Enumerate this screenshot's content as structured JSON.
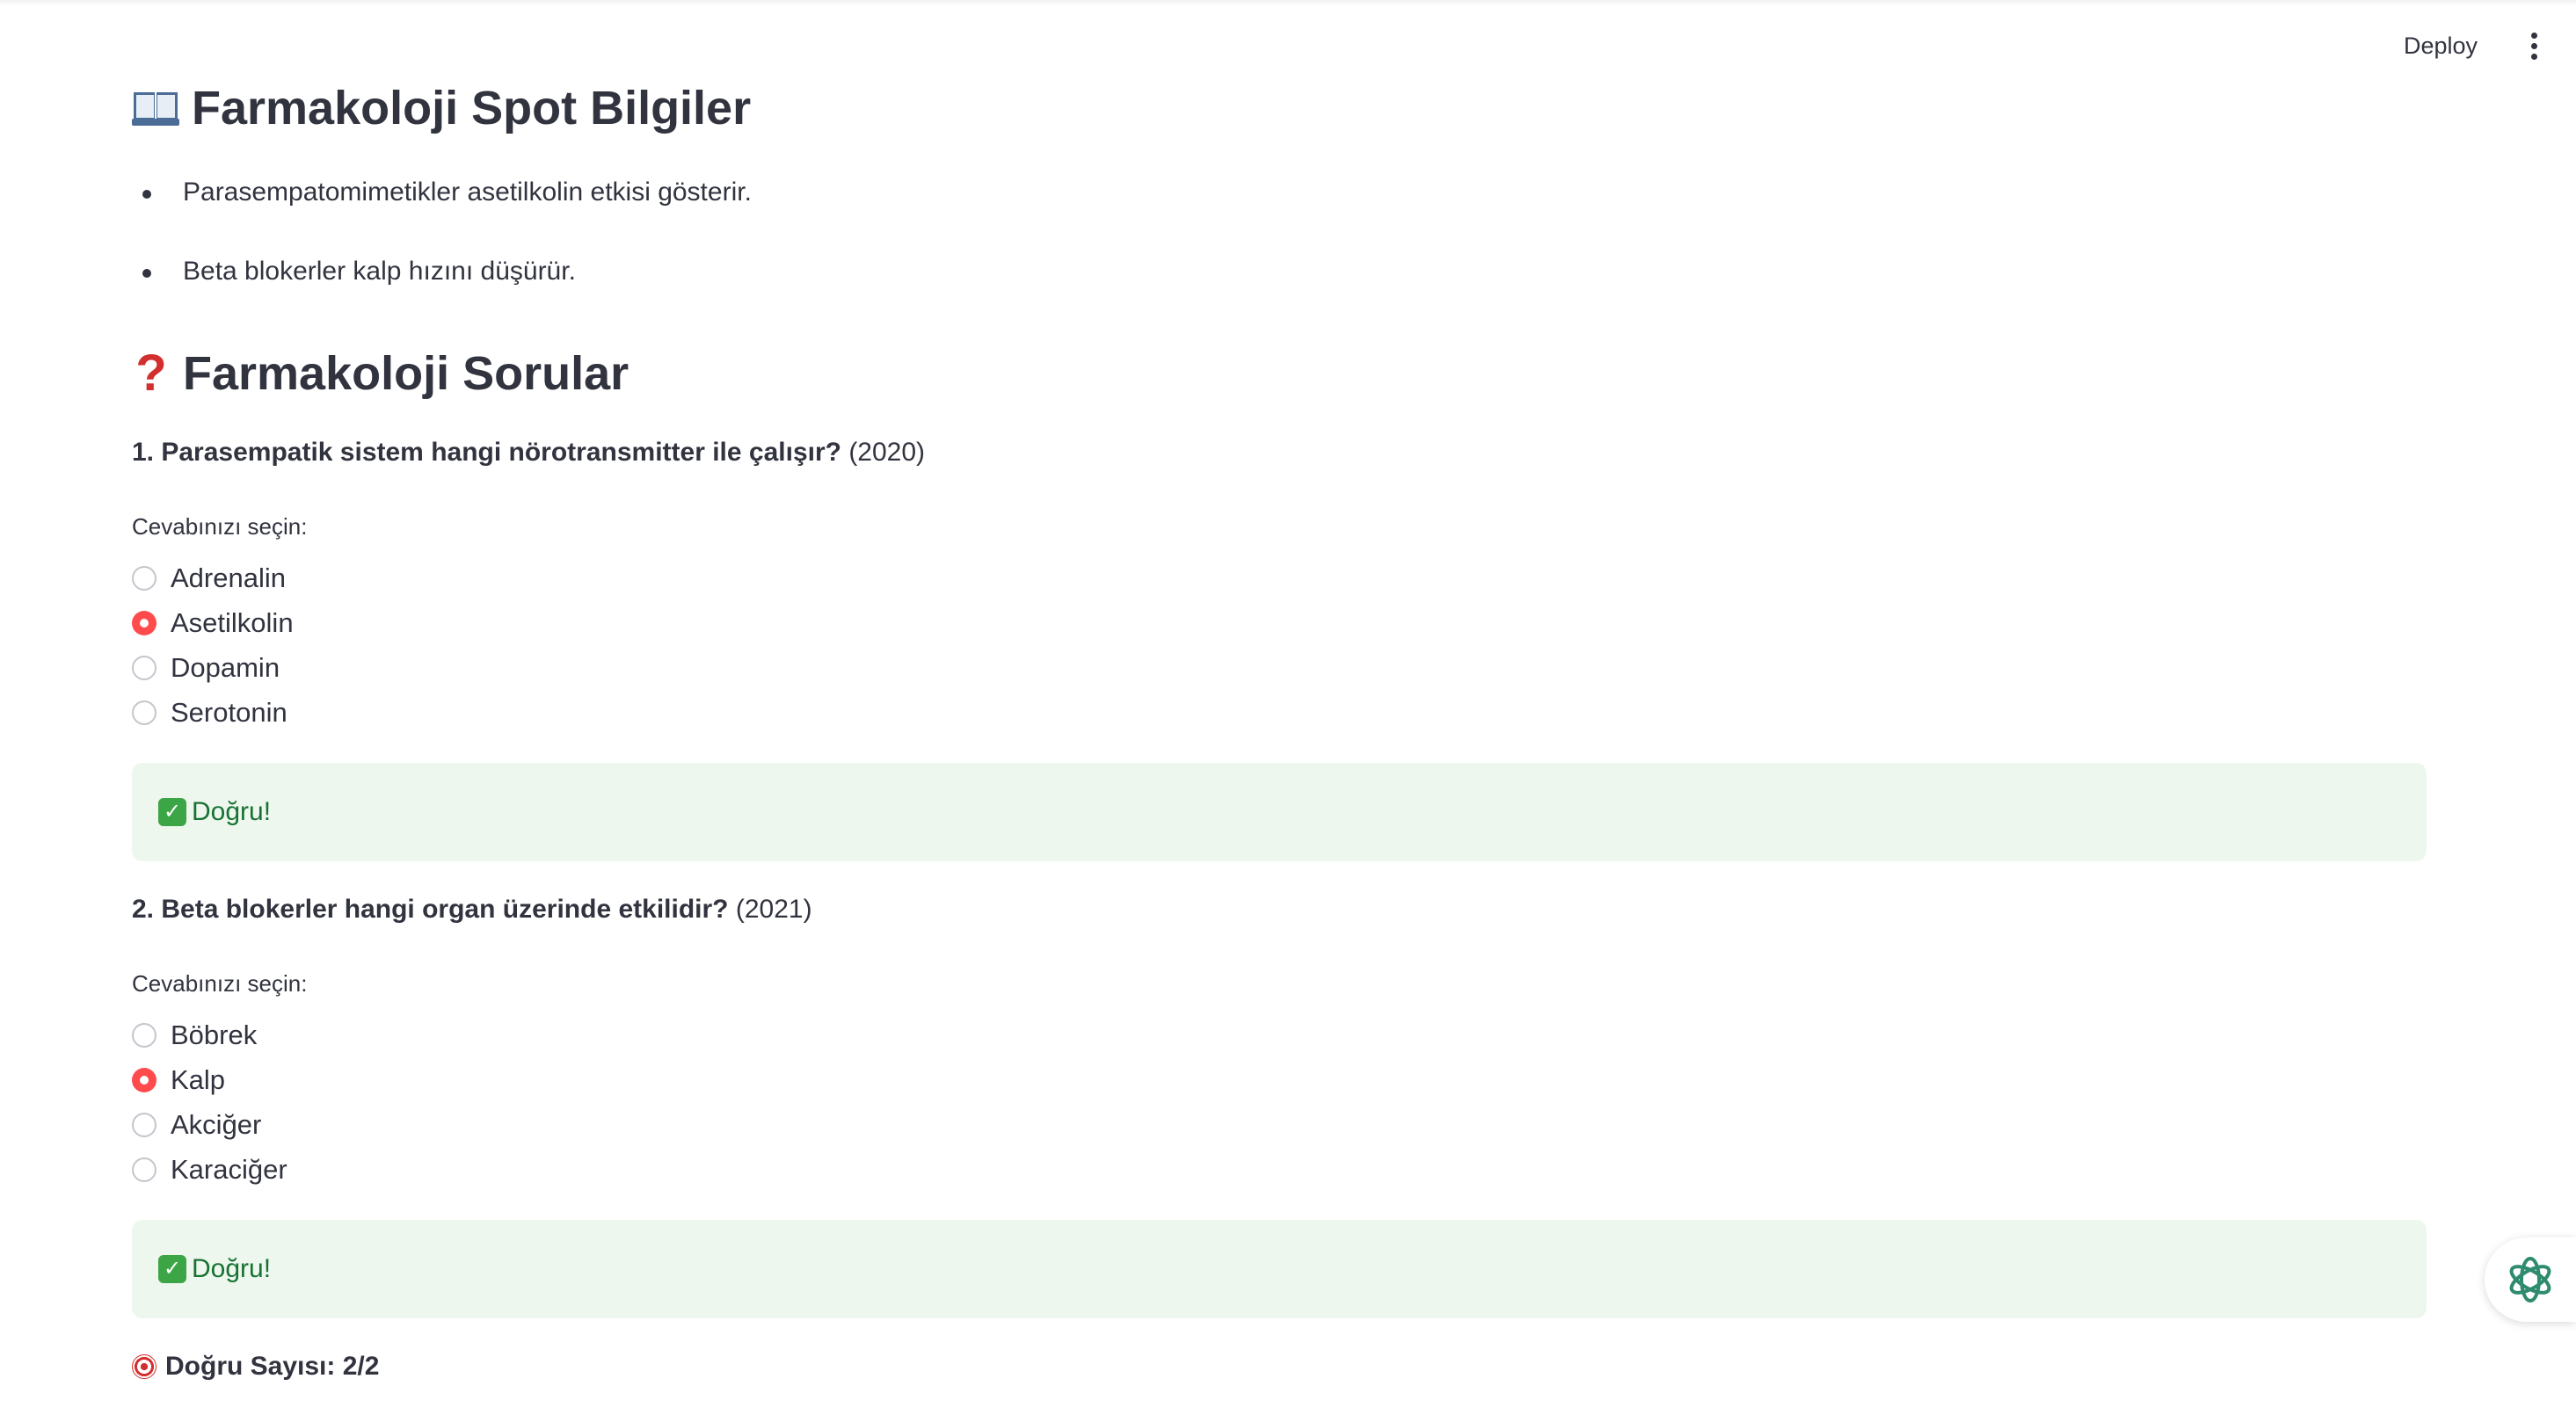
{
  "toolbar": {
    "deploy_label": "Deploy",
    "menu_icon": "vertical-ellipsis-icon"
  },
  "spot": {
    "icon": "open-book-icon",
    "title": "Farmakoloji Spot Bilgiler",
    "items": [
      "Parasempatomimetikler asetilkolin etkisi gösterir.",
      "Beta blokerler kalp hızını düşürür."
    ]
  },
  "quiz": {
    "icon": "red-question-mark-icon",
    "title": "Farmakoloji Sorular",
    "questions": [
      {
        "text": "1. Parasempatik sistem hangi nörotransmitter ile çalışır?",
        "year": "(2020)",
        "prompt": "Cevabınızı seçin:",
        "options": [
          "Adrenalin",
          "Asetilkolin",
          "Dopamin",
          "Serotonin"
        ],
        "selected": "Asetilkolin",
        "result": "Doğru!"
      },
      {
        "text": "2. Beta blokerler hangi organ üzerinde etkilidir?",
        "year": "(2021)",
        "prompt": "Cevabınızı seçin:",
        "options": [
          "Böbrek",
          "Kalp",
          "Akciğer",
          "Karaciğer"
        ],
        "selected": "Kalp",
        "result": "Doğru!"
      }
    ]
  },
  "score": {
    "icon": "target-icon",
    "text": "Doğru Sayısı: 2/2"
  },
  "chat_widget": {
    "icon": "assistant-knot-icon"
  },
  "colors": {
    "accent": "#ff4b4b",
    "success_bg": "#eef7ee",
    "success_text": "#177233",
    "text": "#31333f"
  }
}
